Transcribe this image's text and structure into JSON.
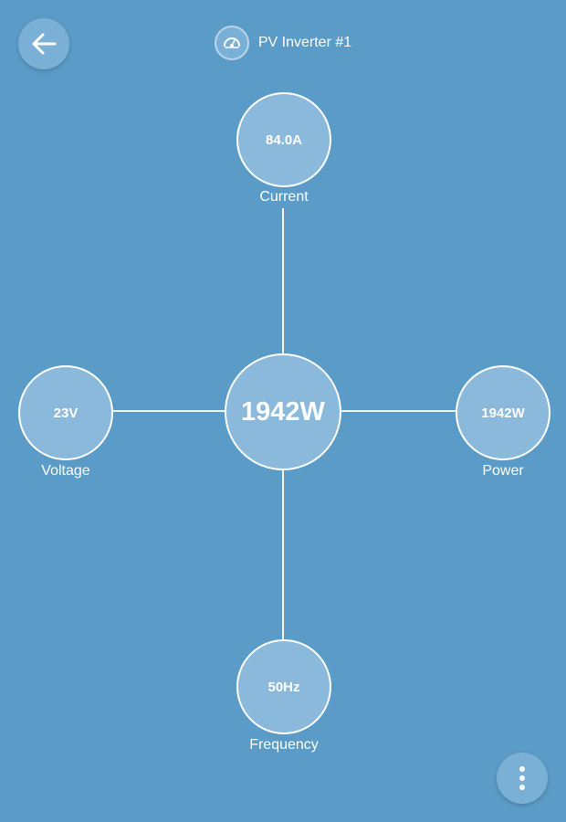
{
  "header": {
    "title": "PV Inverter #1",
    "device_icon": "gauge-icon",
    "back_icon": "arrow-left-icon"
  },
  "center": {
    "value": "1942W"
  },
  "nodes": {
    "current": {
      "value": "84.0A",
      "label": "Current"
    },
    "voltage": {
      "value": "23V",
      "label": "Voltage"
    },
    "power": {
      "value": "1942W",
      "label": "Power"
    },
    "frequency": {
      "value": "50Hz",
      "label": "Frequency"
    }
  },
  "menu": {
    "icon": "more-vertical-icon"
  },
  "colors": {
    "background": "#5b9bc7",
    "node_fill": "#8ab9dc",
    "button_fill": "#7ab0d5",
    "line": "#ffffff"
  }
}
